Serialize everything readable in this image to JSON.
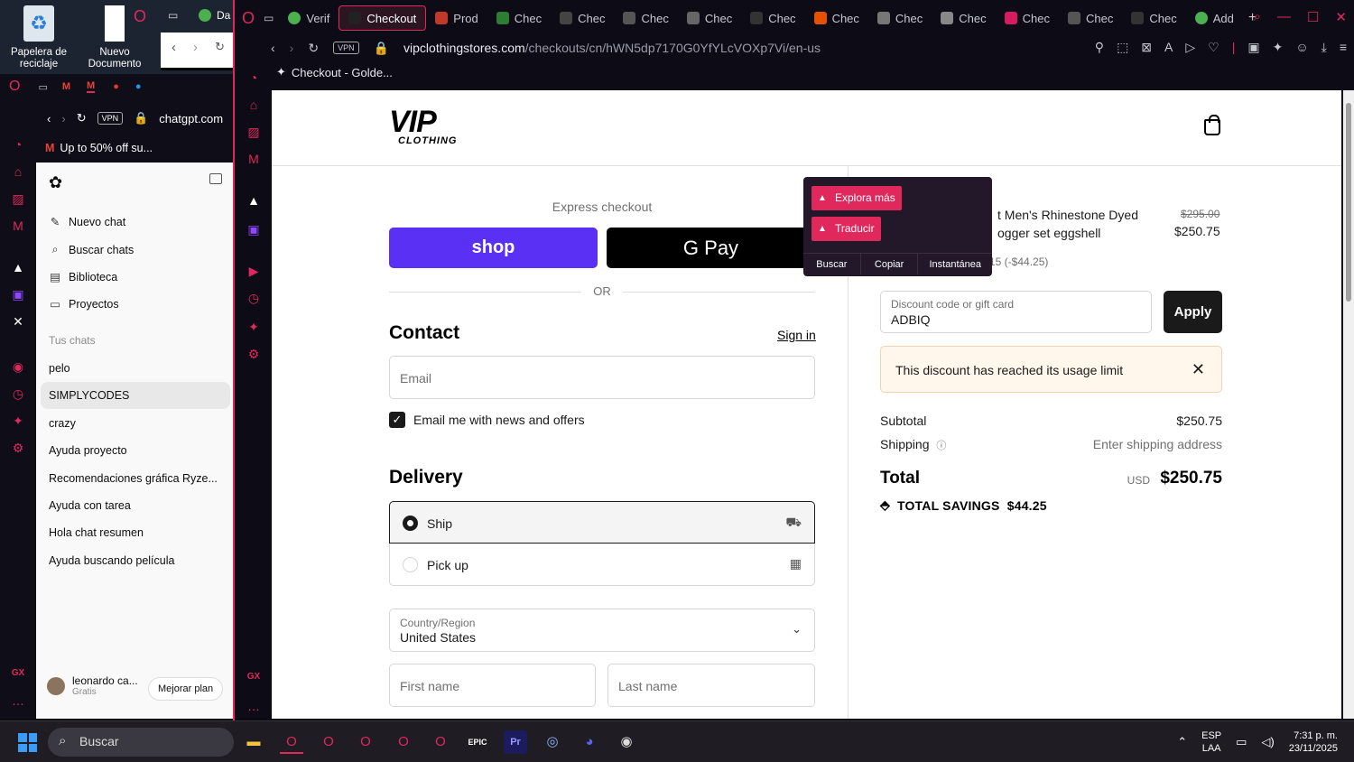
{
  "desktop": {
    "icons": [
      {
        "label": "Papelera de reciclaje"
      },
      {
        "label": "Nuevo Documento"
      },
      {
        "label": "Da"
      }
    ]
  },
  "left_window": {
    "url": "chatgpt.com",
    "bookmark": "Up to 50% off su...",
    "sidebar": {
      "menu": [
        {
          "label": "Nuevo chat",
          "icon": "edit-icon"
        },
        {
          "label": "Buscar chats",
          "icon": "search-icon"
        },
        {
          "label": "Biblioteca",
          "icon": "library-icon"
        },
        {
          "label": "Proyectos",
          "icon": "folder-icon"
        }
      ],
      "section_label": "Tus chats",
      "chats": [
        "pelo",
        "SIMPLYCODES",
        "crazy",
        "Ayuda proyecto",
        "Recomendaciones gráfica Ryze...",
        "Ayuda con tarea",
        "Hola chat resumen",
        "Ayuda buscando película"
      ],
      "active_chat_index": 1,
      "user_name": "leonardo ca...",
      "user_plan": "Gratis",
      "upgrade_label": "Mejorar plan"
    }
  },
  "browser": {
    "tabs": [
      {
        "label": "Verif",
        "color": "#4caf50"
      },
      {
        "label": "Checkout",
        "color": "#222222",
        "active": true
      },
      {
        "label": "Prod",
        "color": "#c0392b"
      },
      {
        "label": "Chec",
        "color": "#2e7d32"
      },
      {
        "label": "Chec",
        "color": "#444444"
      },
      {
        "label": "Chec",
        "color": "#555555"
      },
      {
        "label": "Chec",
        "color": "#666666"
      },
      {
        "label": "Chec",
        "color": "#333333"
      },
      {
        "label": "Chec",
        "color": "#e65100"
      },
      {
        "label": "Chec",
        "color": "#777777"
      },
      {
        "label": "Chec",
        "color": "#888888"
      },
      {
        "label": "Chec",
        "color": "#d81b60"
      },
      {
        "label": "Chec",
        "color": "#555555"
      },
      {
        "label": "Chec",
        "color": "#333333"
      },
      {
        "label": "Add",
        "color": "#4caf50"
      }
    ],
    "url_domain": "vipclothingstores.com",
    "url_path": "/checkouts/cn/hWN5dp7170G0YfYLcVOXp7Vi/en-us",
    "vpn_label": "VPN",
    "bookmark": "Checkout - Golde..."
  },
  "checkout": {
    "brand": "VIP",
    "brand_sub": "CLOTHING",
    "express_label": "Express checkout",
    "shop_label": "shop",
    "gpay_label": "G Pay",
    "or_label": "OR",
    "contact_title": "Contact",
    "signin_label": "Sign in",
    "email_placeholder": "Email",
    "news_label": "Email me with news and offers",
    "delivery_title": "Delivery",
    "ship_label": "Ship",
    "pickup_label": "Pick up",
    "country_label": "Country/Region",
    "country_value": "United States",
    "first_name_placeholder": "First name",
    "last_name_placeholder": "Last name"
  },
  "summary": {
    "product_name_line1": "t Men's Rhinestone Dyed",
    "product_name_line2": "ogger set eggshell",
    "old_price": "$295.00",
    "new_price": "$250.75",
    "discount_line": "15 (-$44.25)",
    "discount_label": "Discount code or gift card",
    "discount_value": "ADBIQ",
    "apply_label": "Apply",
    "alert": "This discount has reached its usage limit",
    "subtotal_label": "Subtotal",
    "subtotal_value": "$250.75",
    "shipping_label": "Shipping",
    "shipping_value": "Enter shipping address",
    "total_label": "Total",
    "currency": "USD",
    "total_value": "$250.75",
    "savings": "TOTAL SAVINGS  $44.25"
  },
  "popup": {
    "btn1": "Explora más",
    "btn2": "Traducir",
    "foot": [
      "Buscar",
      "Copiar",
      "Instantánea"
    ]
  },
  "taskbar": {
    "search": "Buscar",
    "lang1": "ESP",
    "lang2": "LAA",
    "time": "7:31 p. m.",
    "date": "23/11/2025"
  }
}
